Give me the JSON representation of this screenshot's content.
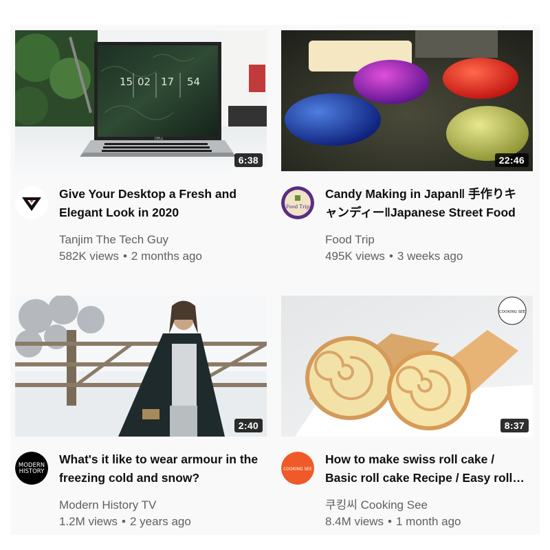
{
  "videos": [
    {
      "title": "Give Your Desktop a Fresh and Elegant Look in 2020",
      "channel": "Tanjim The Tech Guy",
      "views": "582K views",
      "age": "2 months ago",
      "duration": "6:38",
      "clock": [
        "15",
        "02",
        "17",
        "54"
      ],
      "laptop_brand": "DELL"
    },
    {
      "title": "Candy Making in Japan‖ 手作りキャンディー‖Japanese Street Food",
      "channel": "Food Trip",
      "views": "495K views",
      "age": "3 weeks ago",
      "duration": "22:46",
      "avatar_text": "Food Trip"
    },
    {
      "title": "What's it like to wear armour in the freezing cold and snow?",
      "channel": "Modern History TV",
      "views": "1.2M views",
      "age": "2 years ago",
      "duration": "2:40",
      "avatar_text": [
        "MODERN",
        "HISTORY"
      ]
    },
    {
      "title": "How to make swiss roll cake / Basic roll cake Recipe / Easy roll cake",
      "channel": "쿠킹씨 Cooking See",
      "views": "8.4M views",
      "age": "1 month ago",
      "duration": "8:37",
      "avatar_text": "COOKING SEE",
      "watermark": "COOKING SEE"
    }
  ],
  "separator": "•",
  "colors": {
    "background": "#ffffff",
    "grid": "#f9f9f9",
    "title": "#0f0f0f",
    "meta": "#606060",
    "food_trip_avatar": "#5a2d82",
    "cooking_see_avatar": "#f05a28"
  }
}
